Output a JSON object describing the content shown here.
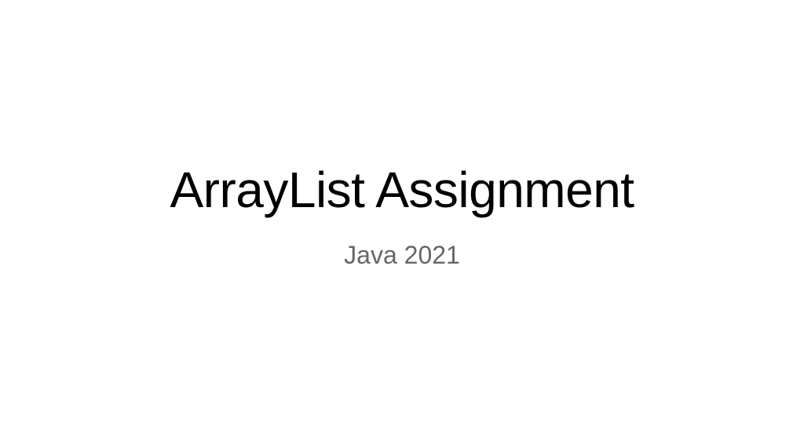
{
  "slide": {
    "title": "ArrayList Assignment",
    "subtitle": "Java 2021"
  }
}
